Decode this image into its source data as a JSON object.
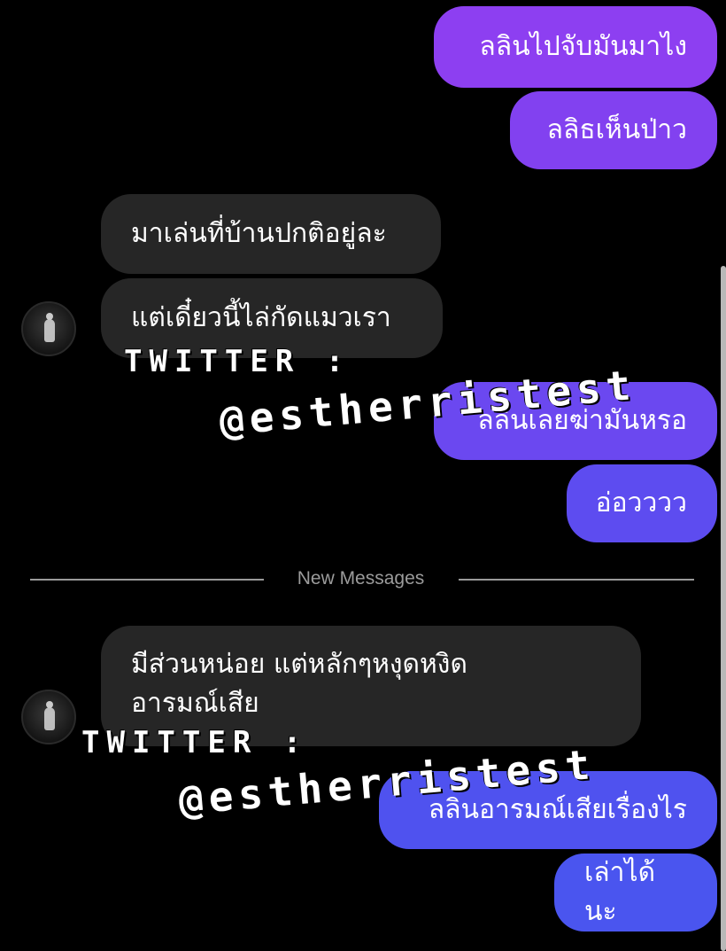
{
  "conversation": {
    "messages": [
      {
        "side": "out",
        "text": "ลลินไปจับมันมาไง"
      },
      {
        "side": "out",
        "text": "ลลิธเห็นป่าว"
      },
      {
        "side": "in",
        "text": "มาเล่นที่บ้านปกติอยู่ละ"
      },
      {
        "side": "in",
        "text": "แต่เดี๋ยวนี้ไล่กัดแมวเรา"
      },
      {
        "side": "out",
        "text": "ลลินเลยฆ่ามันหรอ"
      },
      {
        "side": "out",
        "text": "อ่อวววว"
      },
      {
        "side": "in",
        "text": "มีส่วนหน่อย แต่หลักๆหงุดหงิด อารมณ์เสีย"
      },
      {
        "side": "out",
        "text": "ลลินอารมณ์เสียเรื่องไร"
      },
      {
        "side": "out",
        "text": "เล่าได้นะ"
      }
    ],
    "divider_label": "New Messages"
  },
  "watermark": {
    "line1": "TWITTER :",
    "line2": "@estherristest"
  },
  "colors": {
    "background": "#000000",
    "incoming_bubble": "#262626",
    "outgoing_purple": "#8a3ff0",
    "outgoing_blue": "#4a55ef",
    "divider_text": "#9b9b9b"
  }
}
